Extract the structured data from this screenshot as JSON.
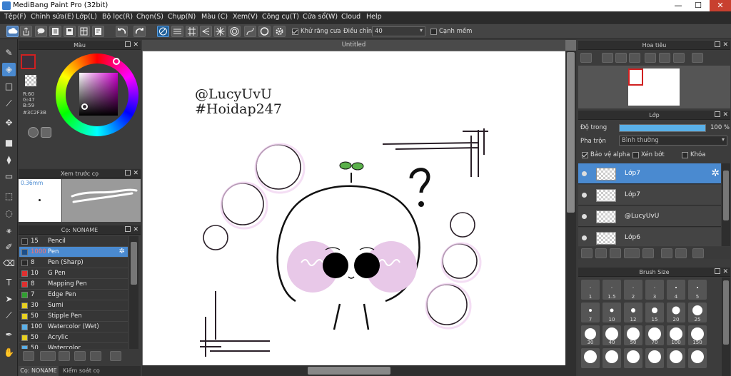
{
  "app": {
    "title": "MediBang Paint Pro (32bit)"
  },
  "window_controls": {
    "minimize": "—",
    "maximize": "☐",
    "close": "✕"
  },
  "menu": [
    "Tệp(F)",
    "Chỉnh sửa(E)",
    "Lớp(L)",
    "Bộ lọc(R)",
    "Chọn(S)",
    "Chụp(N)",
    "Màu (C)",
    "Xem(V)",
    "Công cụ(T)",
    "Cửa sổ(W)",
    "Cloud",
    "Help"
  ],
  "toolbar": {
    "antialias_label": "Khử răng cưa",
    "antialias_checked": true,
    "adjust_label": "Điều chỉnh",
    "adjust_value": "40",
    "snap_label": "Cạnh mềm",
    "snap_checked": false
  },
  "color_panel": {
    "title": "Màu",
    "r": "R:60",
    "g": "G:47",
    "b": "B:59",
    "hex": "#3C2F3B",
    "current_color": "#3c2f3b"
  },
  "brush_preview": {
    "title": "Xem trước cọ",
    "size": "0.36mm"
  },
  "brush_panel": {
    "title": "Cọ: NONAME",
    "items": [
      {
        "num": "15",
        "name": "Pencil",
        "color": "#2a2a2a",
        "selected": false
      },
      {
        "num": "1000",
        "name": "Pen",
        "color": "#1c4f8a",
        "selected": true
      },
      {
        "num": "8",
        "name": "Pen (Sharp)",
        "color": "#2a2a2a",
        "selected": false
      },
      {
        "num": "10",
        "name": "G Pen",
        "color": "#e03030",
        "selected": false
      },
      {
        "num": "8",
        "name": "Mapping Pen",
        "color": "#e03030",
        "selected": false
      },
      {
        "num": "7",
        "name": "Edge Pen",
        "color": "#30a030",
        "selected": false
      },
      {
        "num": "30",
        "name": "Sumi",
        "color": "#e8d020",
        "selected": false
      },
      {
        "num": "50",
        "name": "Stipple Pen",
        "color": "#e8d020",
        "selected": false
      },
      {
        "num": "100",
        "name": "Watercolor (Wet)",
        "color": "#5ab0e8",
        "selected": false
      },
      {
        "num": "50",
        "name": "Acrylic",
        "color": "#e8d020",
        "selected": false
      },
      {
        "num": "50",
        "name": "Watercolor",
        "color": "#5ab0e8",
        "selected": false
      }
    ]
  },
  "bottom_tabs": [
    "Cọ: NONAME",
    "Kiểm soát cọ"
  ],
  "document": {
    "tab": "Untitled"
  },
  "canvas_text": {
    "line1": "@LucyUvU",
    "line2": "#Hoidap247"
  },
  "navigator": {
    "title": "Hoa tiêu"
  },
  "layer_panel": {
    "title": "Lớp",
    "opacity_label": "Độ trong",
    "opacity_value": "100 %",
    "opacity_fraction": 1.0,
    "blend_label": "Pha trộn",
    "blend_value": "Bình thường",
    "protect_alpha": "Bảo vệ alpha",
    "clipping": "Xén bớt",
    "lock": "Khóa",
    "layers": [
      {
        "name": "Lớp7",
        "selected": true
      },
      {
        "name": "Lớp7",
        "selected": false
      },
      {
        "name": "@LucyUvU",
        "selected": false
      },
      {
        "name": "Lớp6",
        "selected": false
      }
    ]
  },
  "brush_size_panel": {
    "title": "Brush Size",
    "sizes": [
      {
        "label": "1",
        "d": 1
      },
      {
        "label": "1.5",
        "d": 1
      },
      {
        "label": "2",
        "d": 1
      },
      {
        "label": "3",
        "d": 1
      },
      {
        "label": "4",
        "d": 2
      },
      {
        "label": "5",
        "d": 2
      },
      {
        "label": "7",
        "d": 4
      },
      {
        "label": "10",
        "d": 5
      },
      {
        "label": "12",
        "d": 6
      },
      {
        "label": "15",
        "d": 8
      },
      {
        "label": "20",
        "d": 11
      },
      {
        "label": "25",
        "d": 14
      },
      {
        "label": "30",
        "d": 16
      },
      {
        "label": "40",
        "d": 18
      },
      {
        "label": "50",
        "d": 18
      },
      {
        "label": "70",
        "d": 18
      },
      {
        "label": "100",
        "d": 18
      },
      {
        "label": "150",
        "d": 18
      },
      {
        "label": "",
        "d": 18
      },
      {
        "label": "",
        "d": 18
      },
      {
        "label": "",
        "d": 18
      },
      {
        "label": "",
        "d": 18
      },
      {
        "label": "",
        "d": 18
      },
      {
        "label": "",
        "d": 18
      }
    ]
  }
}
